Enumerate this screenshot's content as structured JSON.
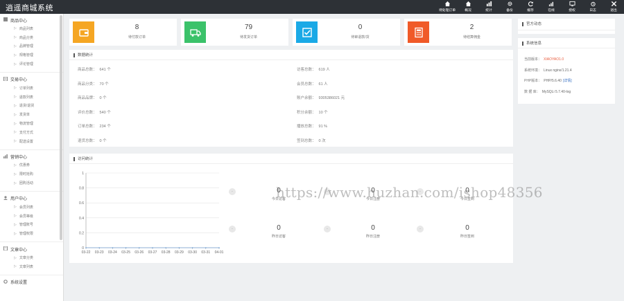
{
  "app": {
    "title": "逍遥商城系统"
  },
  "topnav": [
    {
      "label": "待处理订单",
      "icon": "home-icon"
    },
    {
      "label": "概况",
      "icon": "home-icon"
    },
    {
      "label": "统计",
      "icon": "bar-chart-icon"
    },
    {
      "label": "备份",
      "icon": "gear-icon"
    },
    {
      "label": "缓存",
      "icon": "refresh-icon"
    },
    {
      "label": "在线",
      "icon": "signal-icon",
      "badge": ""
    },
    {
      "label": "授权",
      "icon": "monitor-icon"
    },
    {
      "label": "日志",
      "icon": "alarm-icon"
    },
    {
      "label": "退出",
      "icon": "close-icon"
    }
  ],
  "sidebar": [
    {
      "title": "商品中心",
      "icon": "grid-icon",
      "items": [
        "商品列表",
        "商品分类",
        "品牌管理",
        "规格管理",
        "评论管理"
      ]
    },
    {
      "title": "交易中心",
      "icon": "doc-icon",
      "items": [
        "订单列表",
        "退款列表",
        "退货/退货",
        "发货单",
        "物流管理",
        "支付方式",
        "配送设置"
      ]
    },
    {
      "title": "营销中心",
      "icon": "bar-icon",
      "items": [
        "优惠券",
        "限时抢购",
        "团购活动"
      ]
    },
    {
      "title": "用户中心",
      "icon": "user-icon",
      "items": [
        "会员列表",
        "会员等级",
        "管理账号",
        "管理权限"
      ]
    },
    {
      "title": "文章中心",
      "icon": "article-icon",
      "items": [
        "文章分类",
        "文章列表"
      ]
    },
    {
      "title": "系统设置",
      "icon": "gear-icon",
      "items": []
    }
  ],
  "stats": [
    {
      "value": "8",
      "label": "待付款订单",
      "color": "#f5a623",
      "icon": "wallet-icon"
    },
    {
      "value": "79",
      "label": "待发货订单",
      "color": "#3bc26a",
      "icon": "truck-icon"
    },
    {
      "value": "0",
      "label": "待审退款/货",
      "color": "#1aa9e6",
      "icon": "check-square-icon"
    },
    {
      "value": "2",
      "label": "待结算佣金",
      "color": "#f05a28",
      "icon": "calculator-icon"
    }
  ],
  "data_panel": {
    "title": "数据统计",
    "left": [
      {
        "label": "商品总数：",
        "value": "641 个"
      },
      {
        "label": "商品分类：",
        "value": "70 个"
      },
      {
        "label": "商品品牌：",
        "value": "0 个"
      },
      {
        "label": "评价总数：",
        "value": "540 个"
      },
      {
        "label": "订单总数：",
        "value": "234 个"
      },
      {
        "label": "退货总数：",
        "value": "0 个"
      }
    ],
    "right": [
      {
        "label": "访客总数：",
        "value": "619 人"
      },
      {
        "label": "会员总数：",
        "value": "61 人"
      },
      {
        "label": "账户余额：",
        "value": "9305386021 元"
      },
      {
        "label": "积分余额：",
        "value": "10 个"
      },
      {
        "label": "播放总数：",
        "value": "91 %"
      },
      {
        "label": "签到总数：",
        "value": "0 次"
      }
    ]
  },
  "official": {
    "title": "官方动态"
  },
  "sysinfo": {
    "title": "系统信息",
    "rows": [
      {
        "label": "当前版本：",
        "value": "XIAOYAO1.0",
        "accent": true
      },
      {
        "label": "系统环境：",
        "value": "Linux nginx/1.21.4"
      },
      {
        "label": "PHP版本：",
        "value": "PHP/5.6.40",
        "link": "[详情]"
      },
      {
        "label": "数 据 库：",
        "value": "MySQLi 5.7.40-log"
      }
    ]
  },
  "trend_panel": {
    "title": "访问统计"
  },
  "chart_data": {
    "type": "line",
    "x": [
      "03-22",
      "03-23",
      "03-24",
      "03-25",
      "03-26",
      "03-27",
      "03-28",
      "03-29",
      "03-30",
      "03-31",
      "04-01"
    ],
    "series": [
      {
        "values": [
          0,
          0,
          0,
          0,
          0,
          0,
          0,
          0,
          0,
          0,
          0
        ]
      }
    ],
    "yticks": [
      "0",
      "0.2",
      "0.4",
      "0.6",
      "0.8",
      "1"
    ],
    "ylim": [
      0,
      1
    ],
    "grid": true
  },
  "overview": {
    "top": [
      {
        "value": "0",
        "label": "今日访客"
      },
      {
        "value": "0",
        "label": "今日注册"
      },
      {
        "value": "0",
        "label": "今日签到"
      }
    ],
    "bottom": [
      {
        "value": "0",
        "label": "昨日访客"
      },
      {
        "value": "0",
        "label": "昨日注册"
      },
      {
        "value": "0",
        "label": "昨日签到"
      }
    ],
    "bubble": "-"
  },
  "watermark": "https://www.huzhan.com/ishop48356"
}
